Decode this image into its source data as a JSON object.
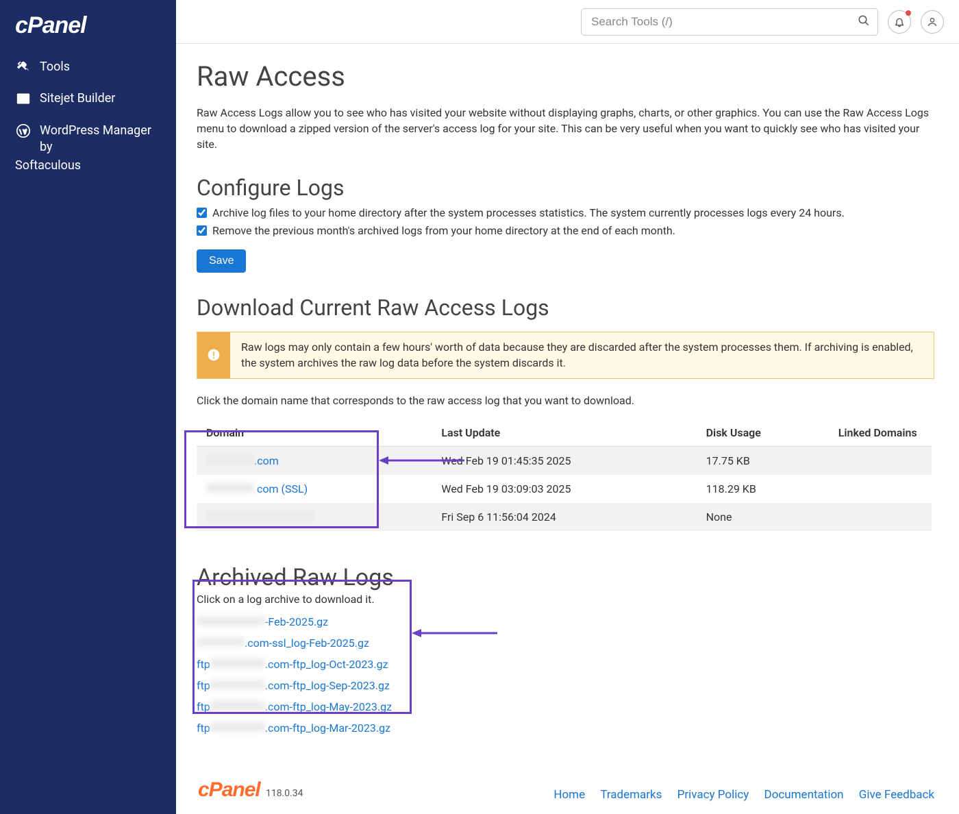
{
  "brand": "cPanel",
  "sidebar": {
    "items": [
      {
        "label": "Tools"
      },
      {
        "label": "Sitejet Builder"
      },
      {
        "label": "WordPress Manager by"
      }
    ],
    "softaculous_tail": "Softaculous"
  },
  "search": {
    "placeholder": "Search Tools (/)"
  },
  "page": {
    "title": "Raw Access",
    "intro": "Raw Access Logs allow you to see who has visited your website without displaying graphs, charts, or other graphics. You can use the Raw Access Logs menu to download a zipped version of the server's access log for your site. This can be very useful when you want to quickly see who has visited your site."
  },
  "configure": {
    "heading": "Configure Logs",
    "option1": "Archive log files to your home directory after the system processes statistics. The system currently processes logs every 24 hours.",
    "option2": "Remove the previous month's archived logs from your home directory at the end of each month.",
    "save_label": "Save"
  },
  "download": {
    "heading": "Download Current Raw Access Logs",
    "alert": "Raw logs may only contain a few hours' worth of data because they are discarded after the system processes them. If archiving is enabled, the system archives the raw log data before the system discards it.",
    "instruction": "Click the domain name that corresponds to the raw access log that you want to download.",
    "columns": {
      "domain": "Domain",
      "update": "Last Update",
      "disk": "Disk Usage",
      "linked": "Linked Domains"
    },
    "rows": [
      {
        "domain_visible": ".com",
        "update": "Wed Feb 19 01:45:35 2025",
        "disk": "17.75 KB"
      },
      {
        "domain_visible": "com (SSL)",
        "update": "Wed Feb 19 03:09:03 2025",
        "disk": "118.29 KB"
      },
      {
        "domain_visible": "",
        "update": "Fri Sep 6 11:56:04 2024",
        "disk": "None"
      }
    ]
  },
  "archived": {
    "heading": "Archived Raw Logs",
    "sub": "Click on a log archive to download it.",
    "files": [
      {
        "prefix": "",
        "suffix": "-Feb-2025.gz"
      },
      {
        "prefix": "",
        "suffix": ".com-ssl_log-Feb-2025.gz"
      },
      {
        "prefix": "ftp",
        "suffix": ".com-ftp_log-Oct-2023.gz"
      },
      {
        "prefix": "ftp",
        "suffix": ".com-ftp_log-Sep-2023.gz"
      },
      {
        "prefix": "ftp",
        "suffix": ".com-ftp_log-May-2023.gz"
      },
      {
        "prefix": "ftp",
        "suffix": ".com-ftp_log-Mar-2023.gz"
      }
    ]
  },
  "footer": {
    "brand": "cPanel",
    "version": "118.0.34",
    "links": [
      "Home",
      "Trademarks",
      "Privacy Policy",
      "Documentation",
      "Give Feedback"
    ]
  }
}
